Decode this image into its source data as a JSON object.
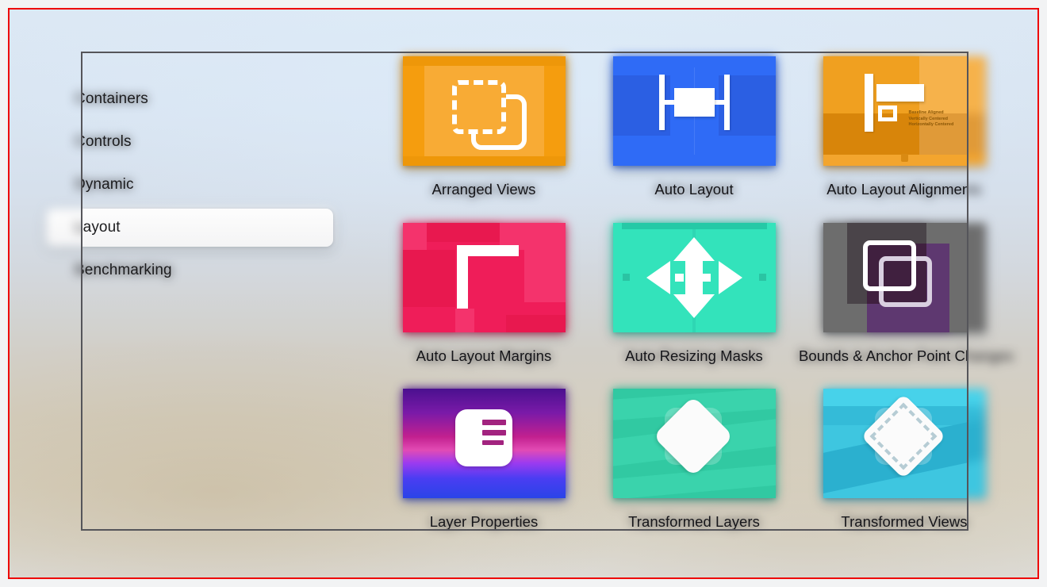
{
  "window": {
    "focus_frame_color": "#55555a",
    "annotation_border_color": "#ee0000"
  },
  "sidebar": {
    "items": [
      {
        "label": "Containers",
        "selected": false
      },
      {
        "label": "Controls",
        "selected": false
      },
      {
        "label": "Dynamic",
        "selected": false
      },
      {
        "label": "Layout",
        "selected": true
      },
      {
        "label": "Benchmarking",
        "selected": false
      }
    ]
  },
  "gallery": {
    "tiles": [
      {
        "label": "Arranged Views",
        "icon": "stacked-squares-icon",
        "accent": "#f5a01b"
      },
      {
        "label": "Auto Layout",
        "icon": "constraint-icon",
        "accent": "#2f6bf6"
      },
      {
        "label": "Auto Layout Alignments",
        "icon": "alignment-icon",
        "accent": "#f0a020"
      },
      {
        "label": "Auto Layout Margins",
        "icon": "margin-corner-icon",
        "accent": "#ef1d59"
      },
      {
        "label": "Auto Resizing Masks",
        "icon": "four-way-arrow-icon",
        "accent": "#33e3bb"
      },
      {
        "label": "Bounds & Anchor Point Changes",
        "icon": "overlapping-squares-icon",
        "accent": "#6d6d6d"
      },
      {
        "label": "Layer Properties",
        "icon": "layer-card-icon",
        "accent": "#7a1aa8"
      },
      {
        "label": "Transformed Layers",
        "icon": "rotated-square-icon",
        "accent": "#31c9a2"
      },
      {
        "label": "Transformed Views",
        "icon": "rotated-dashed-square-icon",
        "accent": "#3ec6e0"
      }
    ],
    "alignment_tile_annotations": {
      "line1": "Baseline Aligned",
      "line2": "Vertically Centered",
      "line3": "Horizontally Centered"
    }
  }
}
